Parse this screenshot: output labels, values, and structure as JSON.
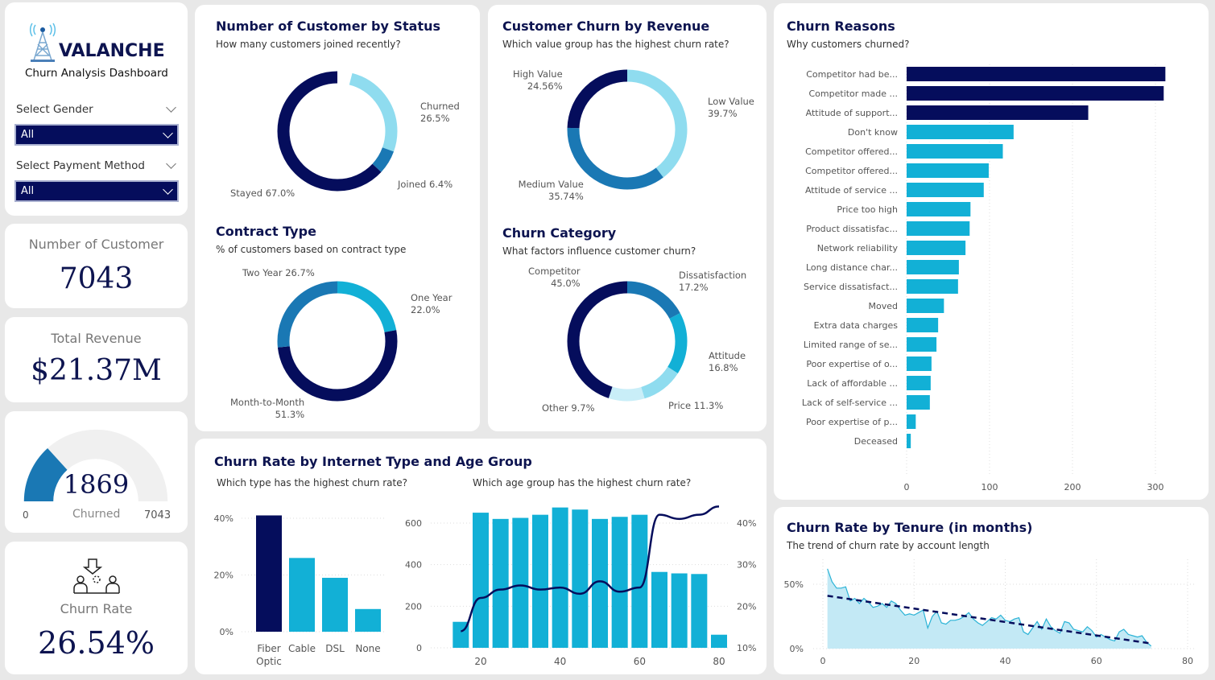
{
  "brand": {
    "logo_text": "VALANCHE",
    "subtitle": "Churn Analysis Dashboard"
  },
  "filters": {
    "gender_label": "Select Gender",
    "gender_value": "All",
    "payment_label": "Select Payment Method",
    "payment_value": "All"
  },
  "kpis": {
    "customers_label": "Number of Customer",
    "customers_value": "7043",
    "revenue_label": "Total Revenue",
    "revenue_value": "$21.37M",
    "gauge_value": "1869",
    "gauge_label": "Churned",
    "gauge_min": "0",
    "gauge_max": "7043",
    "churn_rate_label": "Churn Rate",
    "churn_rate_value": "26.54%"
  },
  "colors": {
    "navy": "#050d5c",
    "cyan": "#12b0d6",
    "blue": "#1a78b4",
    "light": "#8fdcef",
    "lighter": "#c9eef8",
    "track": "#f0f0f0"
  },
  "chart_data": [
    {
      "id": "status",
      "type": "pie",
      "title": "Number of Customer by Status",
      "subtitle": "How many customers joined recently?",
      "slices": [
        {
          "name": "Churned",
          "value": 26.5,
          "label": "26.5%",
          "color": "#8fdcef"
        },
        {
          "name": "Joined",
          "value": 6.4,
          "label": "6.4%",
          "color": "#1a78b4"
        },
        {
          "name": "Stayed",
          "value": 67.0,
          "label": "67.0%",
          "color": "#050d5c"
        }
      ]
    },
    {
      "id": "revenue",
      "type": "pie",
      "title": "Customer Churn by Revenue",
      "subtitle": "Which value group has the highest churn rate?",
      "slices": [
        {
          "name": "Low Value",
          "value": 39.7,
          "label": "39.7%",
          "color": "#8fdcef"
        },
        {
          "name": "Medium Value",
          "value": 35.74,
          "label": "35.74%",
          "color": "#1a78b4"
        },
        {
          "name": "High Value",
          "value": 24.56,
          "label": "24.56%",
          "color": "#050d5c"
        }
      ]
    },
    {
      "id": "contract",
      "type": "pie",
      "title": "Contract Type",
      "subtitle": "% of customers based on contract type",
      "slices": [
        {
          "name": "One Year",
          "value": 22.0,
          "label": "22.0%",
          "color": "#12b0d6"
        },
        {
          "name": "Month-to-Month",
          "value": 51.3,
          "label": "51.3%",
          "color": "#050d5c"
        },
        {
          "name": "Two Year",
          "value": 26.7,
          "label": "26.7%",
          "color": "#1a78b4"
        }
      ]
    },
    {
      "id": "category",
      "type": "pie",
      "title": "Churn Category",
      "subtitle": "What factors influence customer churn?",
      "slices": [
        {
          "name": "Dissatisfaction",
          "value": 17.2,
          "label": "17.2%",
          "color": "#1a78b4"
        },
        {
          "name": "Attitude",
          "value": 16.8,
          "label": "16.8%",
          "color": "#12b0d6"
        },
        {
          "name": "Price",
          "value": 11.3,
          "label": "11.3%",
          "color": "#8fdcef"
        },
        {
          "name": "Other",
          "value": 9.7,
          "label": "9.7%",
          "color": "#c9eef8"
        },
        {
          "name": "Competitor",
          "value": 45.0,
          "label": "45.0%",
          "color": "#050d5c"
        }
      ]
    },
    {
      "id": "reasons",
      "type": "bar",
      "orientation": "horizontal",
      "title": "Churn Reasons",
      "subtitle": "Why customers churned?",
      "categories": [
        "Competitor had be...",
        "Competitor made ...",
        "Attitude of support...",
        "Don't know",
        "Competitor offered...",
        "Competitor offered...",
        "Attitude of service ...",
        "Price too high",
        "Product dissatisfac...",
        "Network reliability",
        "Long distance char...",
        "Service dissatisfact...",
        "Moved",
        "Extra data charges",
        "Limited range of se...",
        "Poor expertise of o...",
        "Lack of affordable ...",
        "Lack of self-service ...",
        "Poor expertise of p...",
        "Deceased"
      ],
      "values": [
        312,
        310,
        219,
        129,
        116,
        99,
        93,
        77,
        76,
        71,
        63,
        62,
        45,
        38,
        36,
        30,
        29,
        28,
        11,
        5
      ],
      "highlight_top": 3,
      "xlim": [
        0,
        320
      ],
      "xticks": [
        0,
        100,
        200,
        300
      ]
    },
    {
      "id": "internet",
      "type": "bar",
      "title": "Churn Rate by Internet Type and Age Group",
      "subtitle": "Which type has the highest churn rate?",
      "categories": [
        "Fiber Optic",
        "Cable",
        "DSL",
        "None"
      ],
      "values": [
        41,
        26,
        19,
        8
      ],
      "ylim": [
        0,
        45
      ],
      "yticks": [
        "0%",
        "20%",
        "40%"
      ],
      "yvals": [
        0,
        20,
        40
      ]
    },
    {
      "id": "age",
      "type": "bar",
      "subtitle": "Which age group has the highest churn rate?",
      "x": [
        15,
        20,
        25,
        30,
        35,
        40,
        45,
        50,
        55,
        60,
        65,
        70,
        75,
        80
      ],
      "values": [
        125,
        650,
        620,
        625,
        640,
        675,
        665,
        620,
        630,
        640,
        365,
        358,
        355,
        63
      ],
      "line_values": [
        14,
        22,
        24,
        25,
        24,
        24.5,
        23,
        26,
        23.5,
        24.5,
        42,
        41,
        42,
        44
      ],
      "xticks": [
        20,
        40,
        60,
        80
      ],
      "yticks": [
        0,
        200,
        400,
        600
      ],
      "y2ticks": [
        "10%",
        "20%",
        "30%",
        "40%"
      ],
      "y2vals": [
        10,
        20,
        30,
        40
      ]
    },
    {
      "id": "tenure",
      "type": "area",
      "title": "Churn Rate by Tenure (in months)",
      "subtitle": "The trend of churn rate by account length",
      "x_start": 1,
      "values": [
        62,
        52,
        47,
        47,
        48,
        37,
        39,
        35,
        39,
        36,
        32,
        33,
        35,
        32,
        37,
        35,
        30,
        26,
        27,
        26,
        28,
        30,
        16,
        25,
        29,
        20,
        19,
        22,
        22,
        23,
        25,
        28,
        23,
        20,
        18,
        21,
        24,
        23,
        26,
        22,
        21,
        23,
        24,
        13,
        11,
        16,
        21,
        15,
        23,
        17,
        14,
        12,
        21,
        20,
        15,
        14,
        13,
        17,
        14,
        9,
        11,
        9,
        7,
        6,
        13,
        15,
        11,
        10,
        9,
        10,
        5,
        2
      ],
      "trend": [
        41,
        4
      ],
      "xticks": [
        0,
        20,
        40,
        60,
        80
      ],
      "yticks": [
        "0%",
        "50%"
      ],
      "yvals": [
        0,
        50
      ]
    }
  ]
}
